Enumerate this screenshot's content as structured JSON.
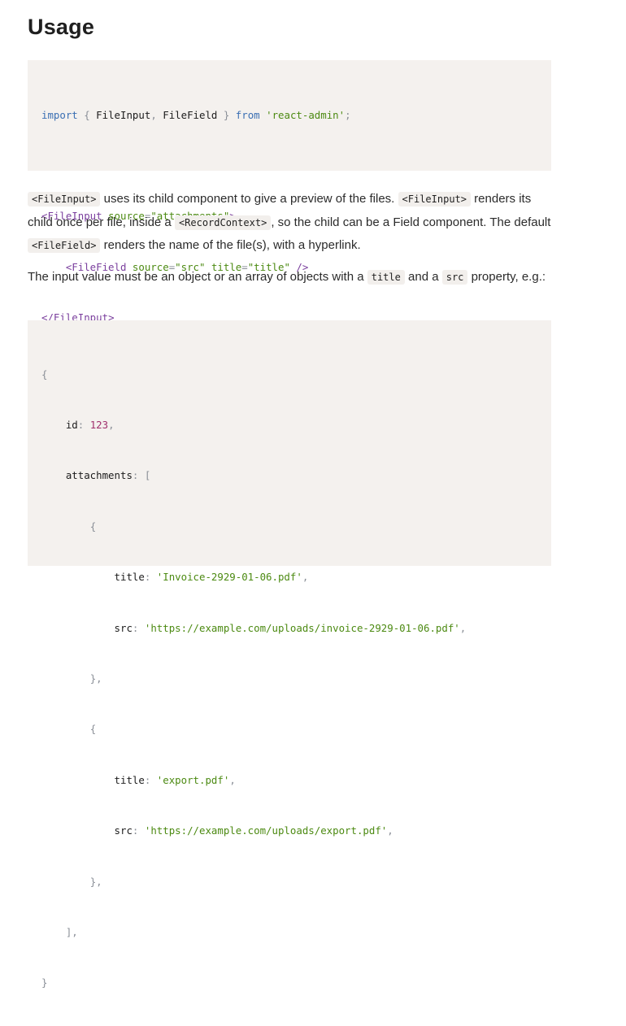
{
  "heading": "Usage",
  "code1": {
    "import_kw": "import",
    "brace_open": "{",
    "name1": "FileInput",
    "comma": ",",
    "name2": "FileField",
    "brace_close": "}",
    "from_kw": "from",
    "module": "'react-admin'",
    "semi": ";",
    "tag_open_fileinput": "<FileInput",
    "attr_source": "source",
    "eq": "=",
    "val_attachments": "\"attachments\"",
    "gt": ">",
    "tag_open_filefield": "<FileField",
    "val_src": "\"src\"",
    "attr_title": "title",
    "val_title": "\"title\"",
    "self_close": "/>",
    "tag_close_fileinput": "</FileInput",
    "tag_close_gt": ">"
  },
  "para1": {
    "code1": "<FileInput>",
    "t1": " uses its child component to give a preview of the files. ",
    "code2": "<FileInput>",
    "t2": " renders its child once per file, inside a ",
    "code3": "<RecordContext>",
    "t3": ", so the child can be a Field component. The default ",
    "code4": "<FileField>",
    "t4": " renders the name of the file(s), with a hyperlink."
  },
  "para2": {
    "t1": "The input value must be an object or an array of objects with a ",
    "code1": "title",
    "t2": " and a ",
    "code2": "src",
    "t3": " property, e.g.:"
  },
  "code2": {
    "open_brace": "{",
    "id_key": "id",
    "colon": ":",
    "id_val": "123",
    "comma": ",",
    "attachments_key": "attachments",
    "open_bracket": "[",
    "obj_open": "{",
    "title_key": "title",
    "src_key": "src",
    "title1": "'Invoice-2929-01-06.pdf'",
    "src1": "'https://example.com/uploads/invoice-2929-01-06.pdf'",
    "obj_close": "},",
    "title2": "'export.pdf'",
    "src2": "'https://example.com/uploads/export.pdf'",
    "close_bracket": "],",
    "close_brace": "}"
  }
}
